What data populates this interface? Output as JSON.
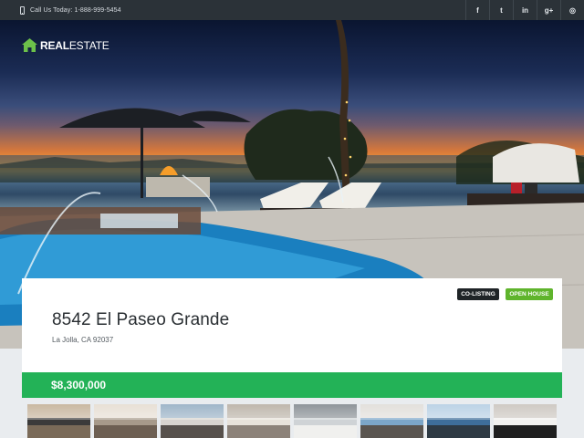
{
  "topbar": {
    "phone_text": "Call Us Today: 1-888-999-5454",
    "social": [
      {
        "icon": "facebook-icon",
        "glyph": "f"
      },
      {
        "icon": "twitter-icon",
        "glyph": "t"
      },
      {
        "icon": "linkedin-icon",
        "glyph": "in"
      },
      {
        "icon": "google-plus-icon",
        "glyph": "g+"
      },
      {
        "icon": "instagram-icon",
        "glyph": "◎"
      }
    ]
  },
  "brand": {
    "bold": "REAL",
    "thin": "ESTATE",
    "accent": "#6cc04a"
  },
  "listing": {
    "address": "8542 El Paseo Grande",
    "city": "La Jolla, CA 92037",
    "badge_coliisting": "CO-LISTING",
    "badge_open": "OPEN HOUSE",
    "price": "$8,300,000"
  },
  "thumbnails": [
    {
      "name": "living-room",
      "colors": [
        "#3b3a3a",
        "#c9b8a2",
        "#7a6a58"
      ]
    },
    {
      "name": "dining-room",
      "colors": [
        "#a79a8a",
        "#e8e0d6",
        "#6d5f52"
      ]
    },
    {
      "name": "lounge",
      "colors": [
        "#d8d4cf",
        "#9fb6c9",
        "#57514c"
      ]
    },
    {
      "name": "bedroom",
      "colors": [
        "#e7e2da",
        "#bfb7ad",
        "#8c8279"
      ]
    },
    {
      "name": "kitchen",
      "colors": [
        "#cfd3d6",
        "#8f959a",
        "#f0f0ee"
      ]
    },
    {
      "name": "ocean-room",
      "colors": [
        "#7ca6c8",
        "#e3e0dc",
        "#5a5550"
      ]
    },
    {
      "name": "patio-view",
      "colors": [
        "#3e6e9a",
        "#bcd3e6",
        "#2e3a44"
      ]
    },
    {
      "name": "modern-lounge",
      "colors": [
        "#f2f1ef",
        "#cfcac4",
        "#1f1f1f"
      ]
    }
  ]
}
